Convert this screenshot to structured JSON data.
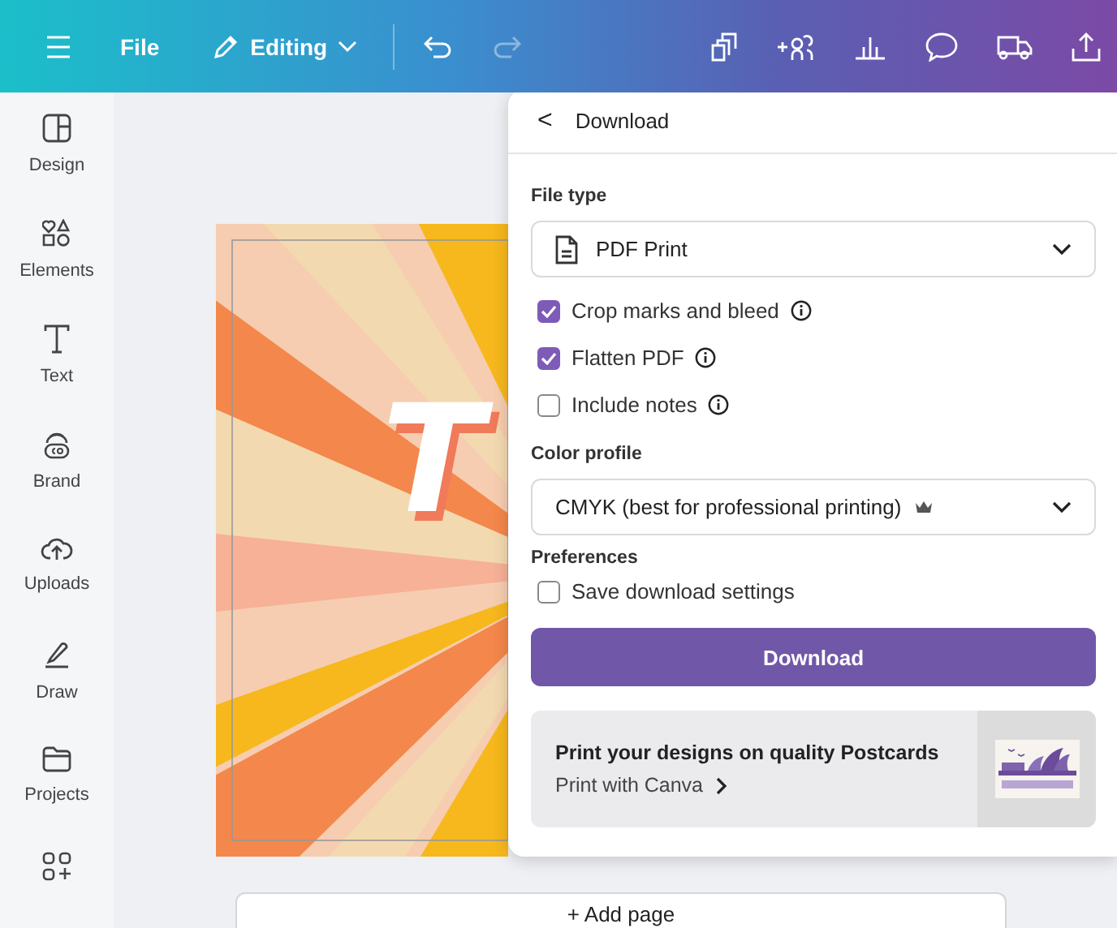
{
  "topbar": {
    "file_label": "File",
    "mode_label": "Editing",
    "redo_disabled": true
  },
  "sidebar": {
    "items": [
      {
        "label": "Design"
      },
      {
        "label": "Elements"
      },
      {
        "label": "Text"
      },
      {
        "label": "Brand"
      },
      {
        "label": "Uploads"
      },
      {
        "label": "Draw"
      },
      {
        "label": "Projects"
      }
    ]
  },
  "design": {
    "texts": [
      "T"
    ]
  },
  "add_page": "+ Add page",
  "download_panel": {
    "back": "<",
    "title": "Download",
    "file_type": {
      "label": "File type",
      "value": "PDF Print"
    },
    "options": [
      {
        "label": "Crop marks and bleed",
        "checked": true,
        "info": true
      },
      {
        "label": "Flatten PDF",
        "checked": true,
        "info": true
      },
      {
        "label": "Include notes",
        "checked": false,
        "info": true
      }
    ],
    "color_profile": {
      "label": "Color profile",
      "value": "CMYK (best for professional printing)",
      "premium": true
    },
    "preferences": {
      "label": "Preferences",
      "options": [
        {
          "label": "Save download settings",
          "checked": false
        }
      ]
    },
    "download_button": "Download",
    "promo": {
      "title": "Print your designs on quality Postcards",
      "link": "Print with Canva"
    }
  }
}
